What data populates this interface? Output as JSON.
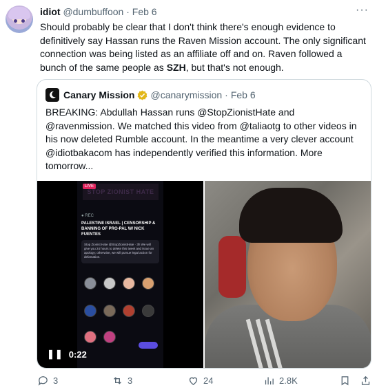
{
  "post": {
    "display_name": "idiot",
    "handle": "@dumbuffoon",
    "separator": "·",
    "date": "Feb 6",
    "more_label": "···",
    "text_part1": "Should probably be clear that I don't think there's enough evidence to definitively say Hassan runs the Raven Mission account. The only significant connection was being listed as an affiliate off and on. Raven followed a bunch of the same people as ",
    "text_bold": "SZH",
    "text_part2": ", but that's not enough."
  },
  "quote": {
    "display_name": "Canary Mission",
    "handle": "@canarymission",
    "separator": "·",
    "date": "Feb 6",
    "text": "BREAKING: Abdullah Hassan runs @StopZionistHate and @ravenmission. We matched this video from @taliaotg to other videos in his now deleted Rumble account. In the meantime a very clever account @idiotbakacom has independently verified this information. More tomorrow...",
    "video": {
      "time": "0:22",
      "pause_glyph": "❚❚",
      "banner": "STOP ZIONIST HATE",
      "live_badge": "LIVE",
      "rec_label": "● REC",
      "title": "PALESTINE ISRAEL | CENSORSHIP & BANNING OF PRO-PAL W/ NICK FUENTES",
      "card_text": "Stop Zionist Hate @StopZionistHate · 3h We will give you 24 hours to delete this tweet and issue an apology; otherwise, we will pursue legal action for defamation."
    }
  },
  "actions": {
    "replies": "3",
    "reposts": "3",
    "likes": "24",
    "views": "2.8K"
  },
  "colors": {
    "text": "#0f1419",
    "muted": "#536471",
    "border": "#cfd9de",
    "verified_gold": "#e2b719"
  }
}
